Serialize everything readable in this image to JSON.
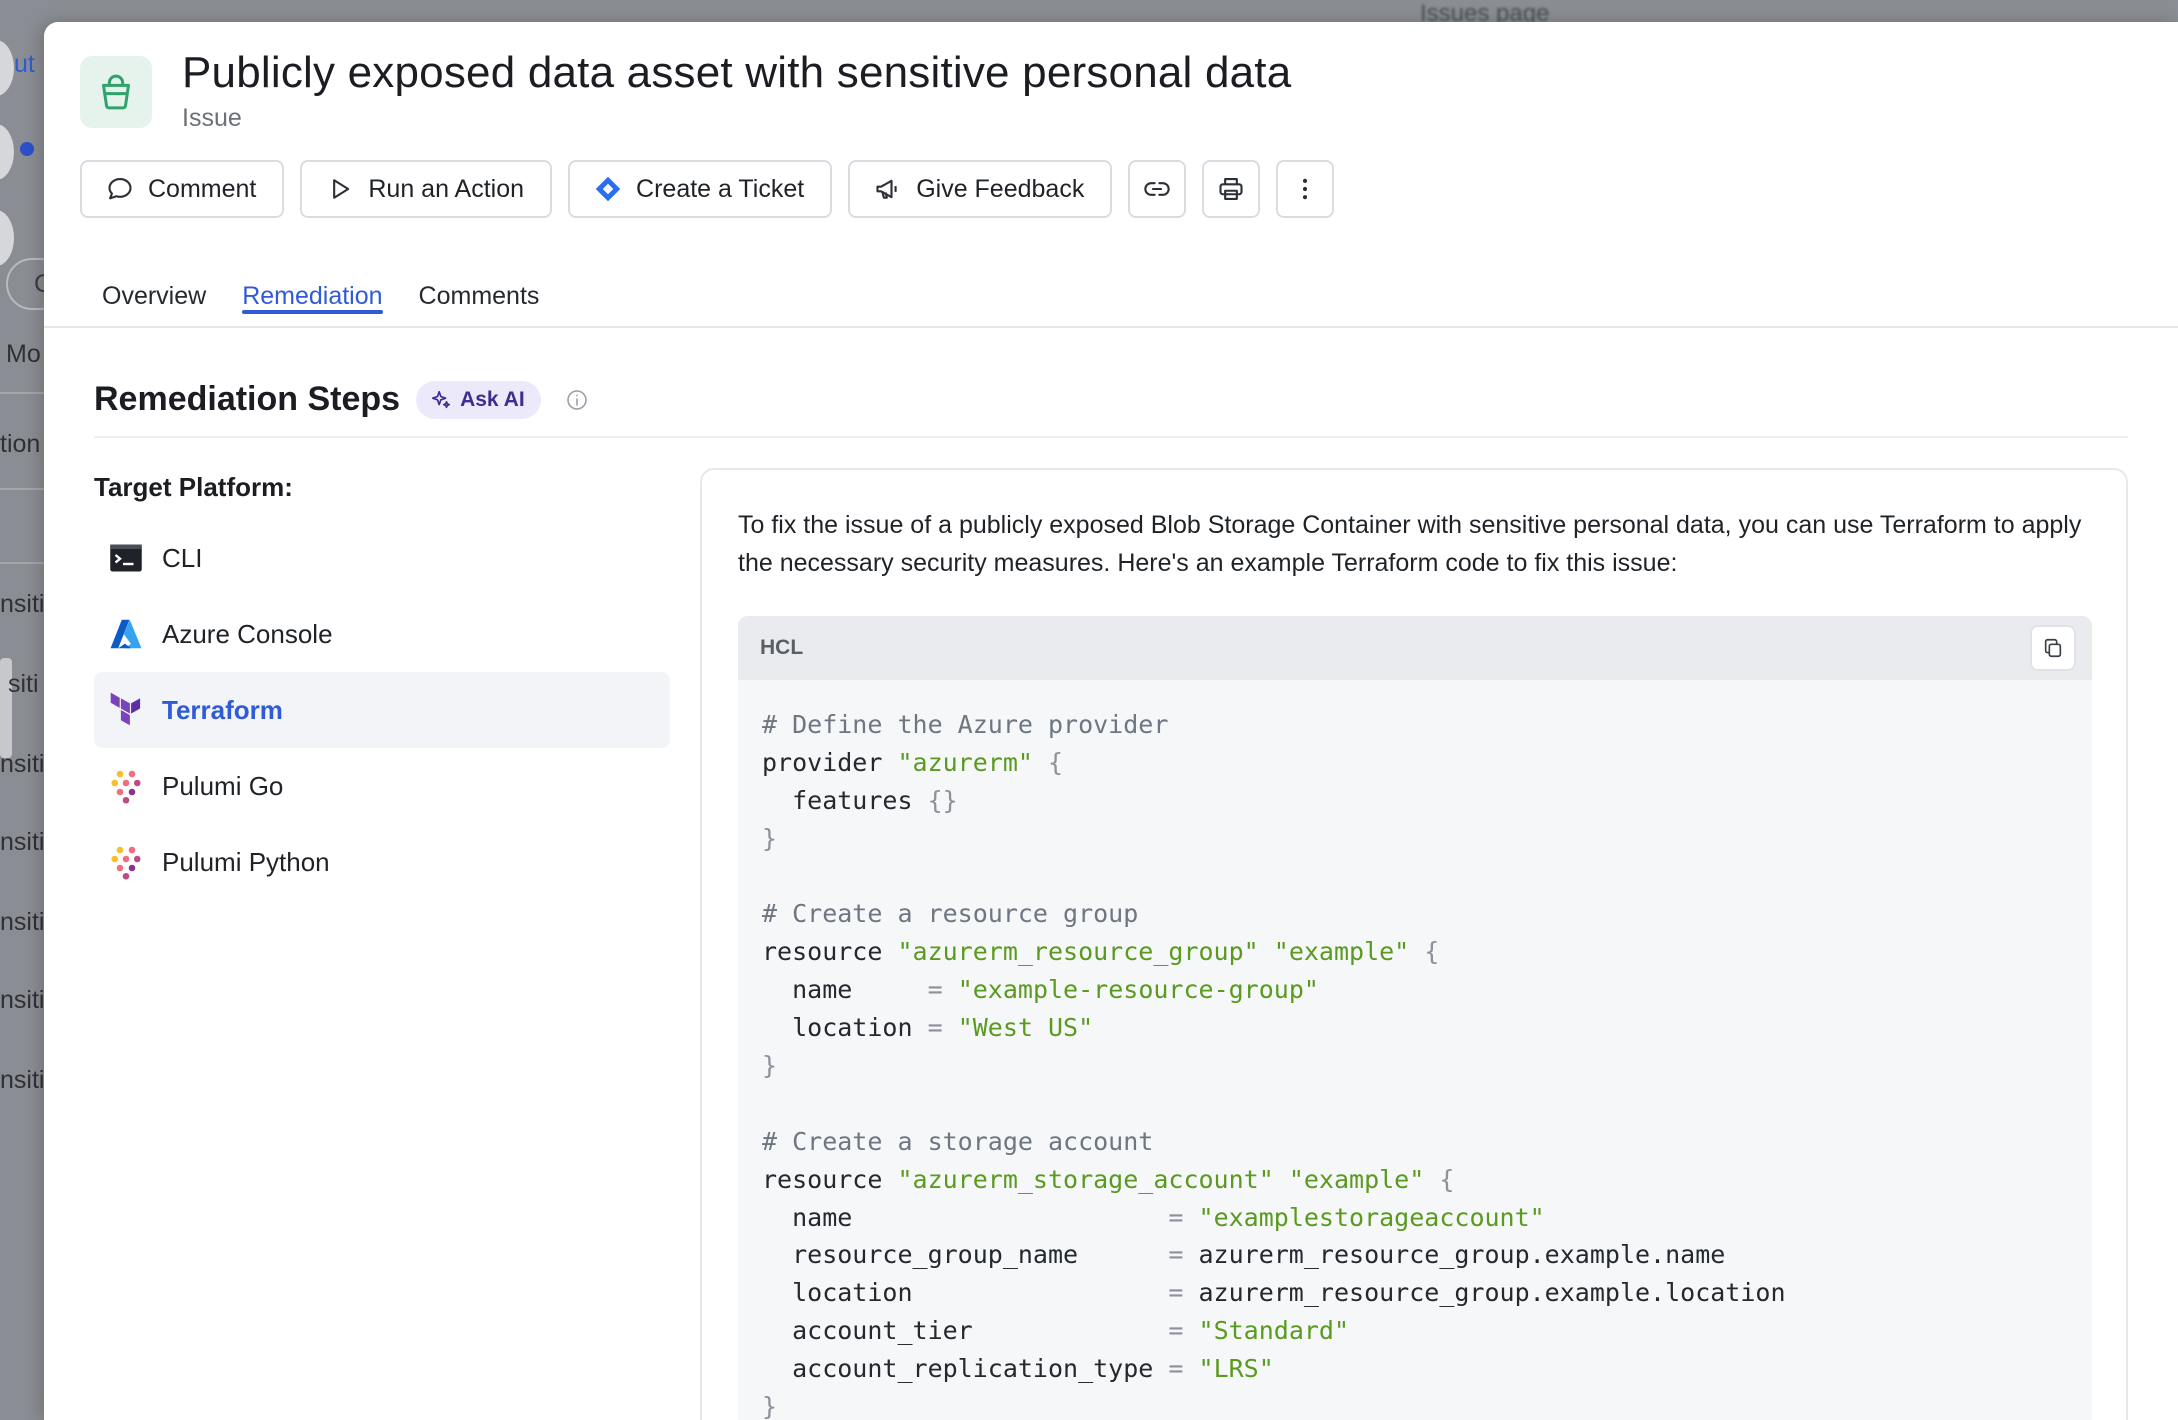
{
  "background": {
    "top_text": "Issues page",
    "fragments": [
      "ut",
      "C",
      "Mo",
      "tion",
      "nsiti",
      "siti",
      "nsiti",
      "nsiti",
      "nsiti",
      "nsiti",
      "nsiti"
    ]
  },
  "header": {
    "title": "Publicly exposed data asset with sensitive personal data",
    "subtitle": "Issue",
    "icon": "bucket-icon",
    "icon_bg": "#e6f3ec",
    "icon_color": "#2fa36b"
  },
  "toolbar": {
    "comment_label": "Comment",
    "run_action_label": "Run an Action",
    "create_ticket_label": "Create a Ticket",
    "give_feedback_label": "Give Feedback"
  },
  "tabs": [
    {
      "label": "Overview",
      "active": false
    },
    {
      "label": "Remediation",
      "active": true
    },
    {
      "label": "Comments",
      "active": false
    }
  ],
  "remediation": {
    "title": "Remediation Steps",
    "ask_ai_label": "Ask AI",
    "target_platform_label": "Target Platform:",
    "platforms": [
      {
        "label": "CLI",
        "icon": "terminal-icon",
        "active": false
      },
      {
        "label": "Azure Console",
        "icon": "azure-icon",
        "active": false
      },
      {
        "label": "Terraform",
        "icon": "terraform-icon",
        "active": true
      },
      {
        "label": "Pulumi Go",
        "icon": "pulumi-icon",
        "active": false
      },
      {
        "label": "Pulumi Python",
        "icon": "pulumi-icon",
        "active": false
      }
    ],
    "intro": "To fix the issue of a publicly exposed Blob Storage Container with sensitive personal data, you can use Terraform to apply the necessary security measures. Here's an example Terraform code to fix this issue:",
    "code_language": "HCL",
    "code_lines": [
      "# Define the Azure provider",
      "provider \"azurerm\" {",
      "  features {}",
      "}",
      "",
      "# Create a resource group",
      "resource \"azurerm_resource_group\" \"example\" {",
      "  name     = \"example-resource-group\"",
      "  location = \"West US\"",
      "}",
      "",
      "# Create a storage account",
      "resource \"azurerm_storage_account\" \"example\" {",
      "  name                     = \"examplestorageaccount\"",
      "  resource_group_name      = azurerm_resource_group.example.name",
      "  location                 = azurerm_resource_group.example.location",
      "  account_tier             = \"Standard\"",
      "  account_replication_type = \"LRS\"",
      "}"
    ]
  },
  "colors": {
    "accent": "#2f5bd6",
    "string": "#5a9a1f",
    "comment": "#6e7681",
    "ask_ai_bg": "#ece9fb"
  }
}
